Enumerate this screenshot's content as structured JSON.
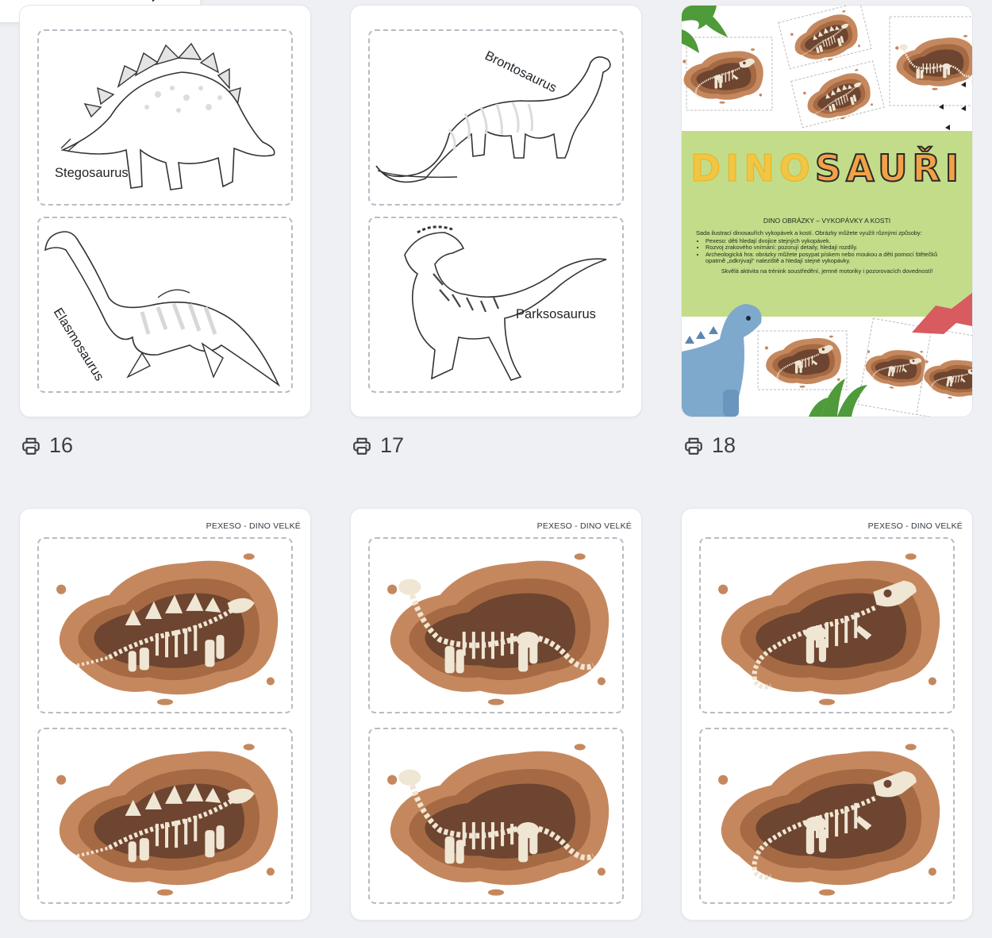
{
  "cards": [
    {
      "type": "coloring",
      "panels": [
        {
          "label": "Stegosaurus"
        },
        {
          "label": "Elasmosaurus"
        }
      ],
      "print_count": "16"
    },
    {
      "type": "coloring",
      "panels": [
        {
          "label": "Brontosaurus"
        },
        {
          "label": "Parksosaurus"
        }
      ],
      "print_count": "17"
    },
    {
      "type": "cover",
      "title_part1": "DINO",
      "title_part2": "SAUŘI",
      "subtitle": "DINO OBRÁZKY – VYKOPÁVKY A KOSTI",
      "intro": "Sada ilustrací dinosauřích vykopávek a kostí. Obrázky můžete využít různými způsoby:",
      "bullets": [
        "Pexeso: děti hledají dvojice stejných vykopávek.",
        "Rozvoj zrakového vnímání: pozorují detaily, hledají rozdíly.",
        "Archeologická hra: obrázky můžete posypat pískem nebo moukou a děti pomocí štětečků opatrně „odkrývají“ naleziště a hledají stejné vykopávky."
      ],
      "closing": "Skvělá aktivita na trénink soustředění, jemné motoriky i pozorovacích dovedností!",
      "print_count": "18"
    },
    {
      "type": "pexeso",
      "header": "PEXESO - DINO VELKÉ",
      "fossil": "stegosaurus-fossil"
    },
    {
      "type": "pexeso",
      "header": "PEXESO - DINO VELKÉ",
      "fossil": "brontosaurus-fossil"
    },
    {
      "type": "pexeso",
      "header": "PEXESO - DINO VELKÉ",
      "fossil": "trex-fossil"
    }
  ],
  "icons": {
    "print": "printer-icon"
  },
  "colors": {
    "background": "#eef0f4",
    "card": "#ffffff",
    "dashed_border": "#b7bcc4",
    "cover_band": "#c3dc8a",
    "dirt_outer": "#c5885e",
    "dirt_mid": "#a56a43",
    "dirt_inner": "#6e4530",
    "bone": "#efe6d4"
  }
}
